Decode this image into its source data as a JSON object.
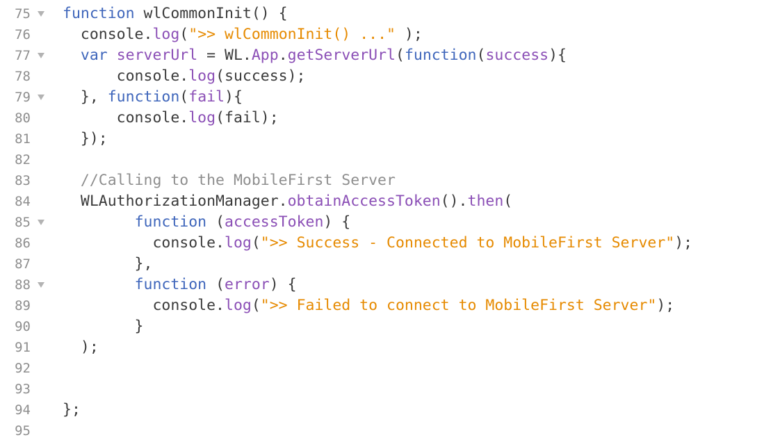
{
  "editor": {
    "colors": {
      "keyword": "#3f66bb",
      "property": "#8b4fb6",
      "string": "#e68a00",
      "comment": "#8e8e8e",
      "plain": "#3a3a3a",
      "line_number": "#8e8e8e",
      "fold_marker": "#b3b3b3"
    },
    "fold_icon": "triangle-down-icon",
    "lines": [
      {
        "num": "75",
        "fold": true,
        "tokens": [
          {
            "t": "kw",
            "s": "function"
          },
          {
            "t": "plain",
            "s": " wlCommonInit() {"
          }
        ]
      },
      {
        "num": "76",
        "fold": false,
        "tokens": [
          {
            "t": "plain",
            "s": "  console."
          },
          {
            "t": "prop",
            "s": "log"
          },
          {
            "t": "plain",
            "s": "("
          },
          {
            "t": "str",
            "s": "\">> wlCommonInit() ...\""
          },
          {
            "t": "plain",
            "s": " );"
          }
        ]
      },
      {
        "num": "77",
        "fold": true,
        "tokens": [
          {
            "t": "plain",
            "s": "  "
          },
          {
            "t": "kw",
            "s": "var"
          },
          {
            "t": "plain",
            "s": " "
          },
          {
            "t": "prop",
            "s": "serverUrl"
          },
          {
            "t": "plain",
            "s": " = WL."
          },
          {
            "t": "prop",
            "s": "App"
          },
          {
            "t": "plain",
            "s": "."
          },
          {
            "t": "prop",
            "s": "getServerUrl"
          },
          {
            "t": "plain",
            "s": "("
          },
          {
            "t": "kw",
            "s": "function"
          },
          {
            "t": "plain",
            "s": "("
          },
          {
            "t": "prop",
            "s": "success"
          },
          {
            "t": "plain",
            "s": "){"
          }
        ]
      },
      {
        "num": "78",
        "fold": false,
        "tokens": [
          {
            "t": "plain",
            "s": "      console."
          },
          {
            "t": "prop",
            "s": "log"
          },
          {
            "t": "plain",
            "s": "(success);"
          }
        ]
      },
      {
        "num": "79",
        "fold": true,
        "tokens": [
          {
            "t": "plain",
            "s": "  }, "
          },
          {
            "t": "kw",
            "s": "function"
          },
          {
            "t": "plain",
            "s": "("
          },
          {
            "t": "prop",
            "s": "fail"
          },
          {
            "t": "plain",
            "s": "){"
          }
        ]
      },
      {
        "num": "80",
        "fold": false,
        "tokens": [
          {
            "t": "plain",
            "s": "      console."
          },
          {
            "t": "prop",
            "s": "log"
          },
          {
            "t": "plain",
            "s": "(fail);"
          }
        ]
      },
      {
        "num": "81",
        "fold": false,
        "tokens": [
          {
            "t": "plain",
            "s": "  });"
          }
        ]
      },
      {
        "num": "82",
        "fold": false,
        "tokens": []
      },
      {
        "num": "83",
        "fold": false,
        "tokens": [
          {
            "t": "comment",
            "s": "  //Calling to the MobileFirst Server"
          }
        ]
      },
      {
        "num": "84",
        "fold": false,
        "tokens": [
          {
            "t": "plain",
            "s": "  WLAuthorizationManager."
          },
          {
            "t": "prop",
            "s": "obtainAccessToken"
          },
          {
            "t": "plain",
            "s": "()."
          },
          {
            "t": "prop",
            "s": "then"
          },
          {
            "t": "plain",
            "s": "("
          }
        ]
      },
      {
        "num": "85",
        "fold": true,
        "tokens": [
          {
            "t": "plain",
            "s": "        "
          },
          {
            "t": "kw",
            "s": "function"
          },
          {
            "t": "plain",
            "s": " ("
          },
          {
            "t": "prop",
            "s": "accessToken"
          },
          {
            "t": "plain",
            "s": ") {"
          }
        ]
      },
      {
        "num": "86",
        "fold": false,
        "tokens": [
          {
            "t": "plain",
            "s": "          console."
          },
          {
            "t": "prop",
            "s": "log"
          },
          {
            "t": "plain",
            "s": "("
          },
          {
            "t": "str",
            "s": "\">> Success - Connected to MobileFirst Server\""
          },
          {
            "t": "plain",
            "s": ");"
          }
        ]
      },
      {
        "num": "87",
        "fold": false,
        "tokens": [
          {
            "t": "plain",
            "s": "        },"
          }
        ]
      },
      {
        "num": "88",
        "fold": true,
        "tokens": [
          {
            "t": "plain",
            "s": "        "
          },
          {
            "t": "kw",
            "s": "function"
          },
          {
            "t": "plain",
            "s": " ("
          },
          {
            "t": "prop",
            "s": "error"
          },
          {
            "t": "plain",
            "s": ") {"
          }
        ]
      },
      {
        "num": "89",
        "fold": false,
        "tokens": [
          {
            "t": "plain",
            "s": "          console."
          },
          {
            "t": "prop",
            "s": "log"
          },
          {
            "t": "plain",
            "s": "("
          },
          {
            "t": "str",
            "s": "\">> Failed to connect to MobileFirst Server\""
          },
          {
            "t": "plain",
            "s": ");"
          }
        ]
      },
      {
        "num": "90",
        "fold": false,
        "tokens": [
          {
            "t": "plain",
            "s": "        }"
          }
        ]
      },
      {
        "num": "91",
        "fold": false,
        "tokens": [
          {
            "t": "plain",
            "s": "  );"
          }
        ]
      },
      {
        "num": "92",
        "fold": false,
        "tokens": []
      },
      {
        "num": "93",
        "fold": false,
        "tokens": []
      },
      {
        "num": "94",
        "fold": false,
        "tokens": [
          {
            "t": "plain",
            "s": "};"
          }
        ]
      },
      {
        "num": "95",
        "fold": false,
        "tokens": []
      }
    ]
  }
}
